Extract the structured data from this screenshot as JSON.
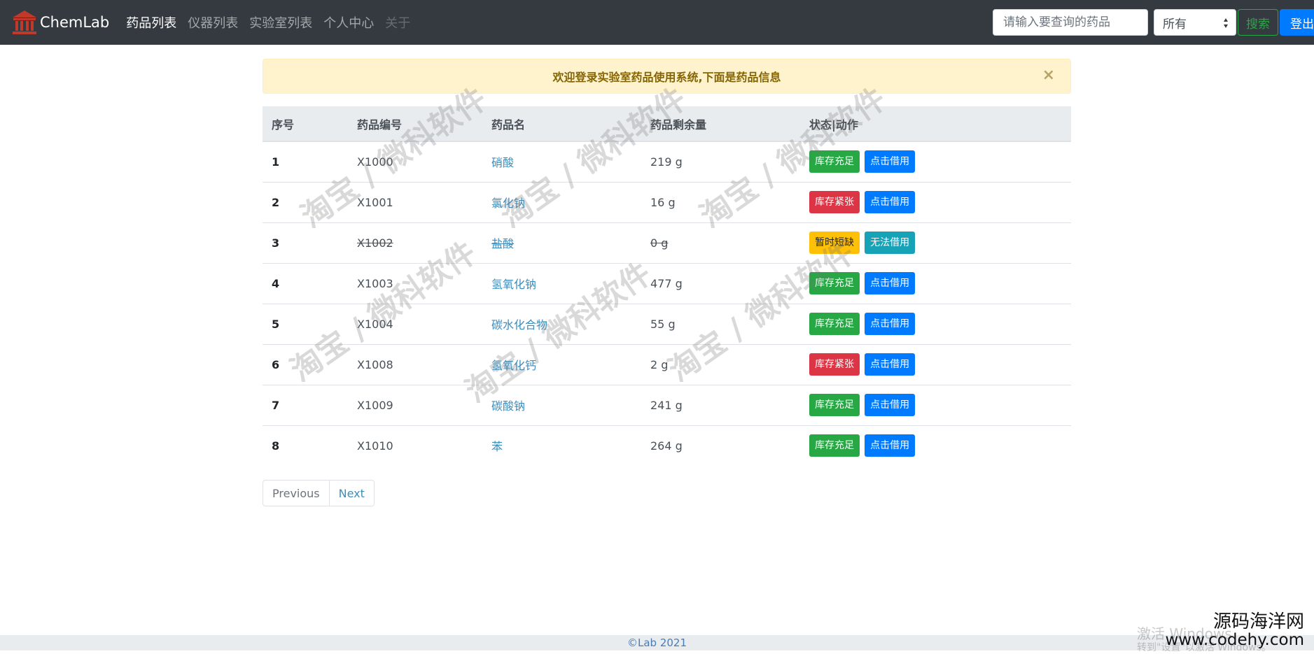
{
  "navbar": {
    "brand": "ChemLab",
    "links": [
      "药品列表",
      "仪器列表",
      "实验室列表",
      "个人中心",
      "关于"
    ],
    "search_placeholder": "请输入要查询的药品",
    "select_value": "所有",
    "search_button": "搜索",
    "logout_button": "登出"
  },
  "alert": {
    "message": "欢迎登录实验室药品使用系统,下面是药品信息",
    "close": "×"
  },
  "table": {
    "headers": [
      "序号",
      "药品编号",
      "药品名",
      "药品剩余量",
      "状态|动作"
    ],
    "rows": [
      {
        "idx": "1",
        "code": "X1000",
        "name": "硝酸",
        "amount": "219 g",
        "status": "库存充足",
        "action": "点击借用"
      },
      {
        "idx": "2",
        "code": "X1001",
        "name": "氯化钠",
        "amount": "16 g",
        "status": "库存紧张",
        "action": "点击借用"
      },
      {
        "idx": "3",
        "code": "X1002",
        "name": "盐酸",
        "amount": "0 g",
        "status": "暂时短缺",
        "action": "无法借用"
      },
      {
        "idx": "4",
        "code": "X1003",
        "name": "氢氧化钠",
        "amount": "477 g",
        "status": "库存充足",
        "action": "点击借用"
      },
      {
        "idx": "5",
        "code": "X1004",
        "name": "碳水化合物",
        "amount": "55 g",
        "status": "库存充足",
        "action": "点击借用"
      },
      {
        "idx": "6",
        "code": "X1008",
        "name": "氢氧化钙",
        "amount": "2 g",
        "status": "库存紧张",
        "action": "点击借用"
      },
      {
        "idx": "7",
        "code": "X1009",
        "name": "碳酸钠",
        "amount": "241 g",
        "status": "库存充足",
        "action": "点击借用"
      },
      {
        "idx": "8",
        "code": "X1010",
        "name": "苯",
        "amount": "264 g",
        "status": "库存充足",
        "action": "点击借用"
      }
    ]
  },
  "pagination": {
    "previous": "Previous",
    "next": "Next"
  },
  "footer": {
    "text": "©Lab 2021"
  },
  "watermark": {
    "text": "淘宝 / 微科软件"
  },
  "overlay": {
    "activate_line1": "激活 Windows",
    "activate_line2": "转到\"设置\"以激活 Windows。",
    "site_name": "源码海洋网",
    "site_url": "www.codehy.com"
  },
  "colors": {
    "navbar_bg": "#343a40",
    "sufficient": "#28a745",
    "low": "#dc3545",
    "shortage": "#ffc107",
    "borrow": "#007bff",
    "unavailable": "#17a2b8",
    "alert_bg": "#fff3cd"
  },
  "icons": {
    "brand": "building-columns-icon",
    "select": "select-arrows-icon",
    "close": "close-icon"
  }
}
